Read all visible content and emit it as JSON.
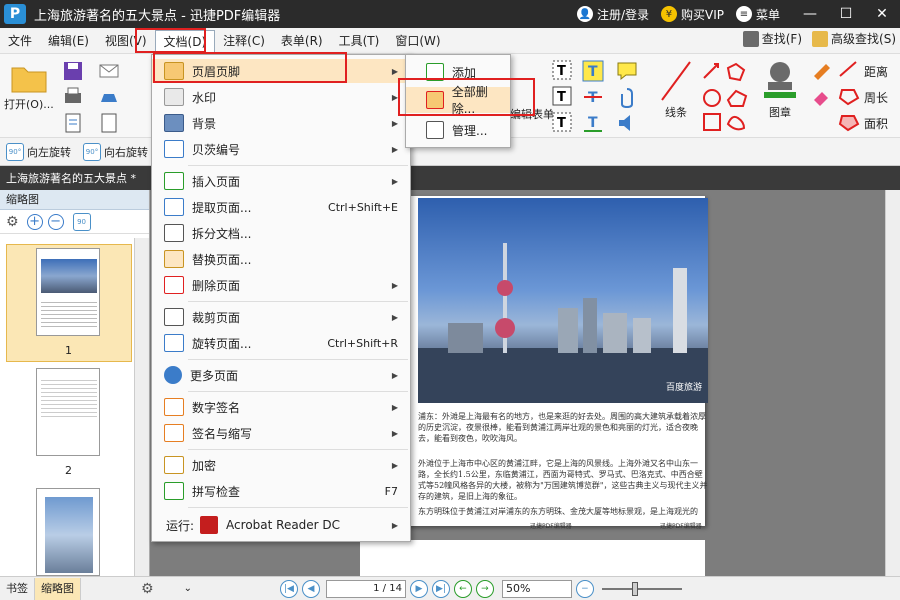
{
  "title_bar": {
    "logo": "P",
    "title": "上海旅游著名的五大景点 - 迅捷PDF编辑器",
    "login": "注册/登录",
    "vip": "购买VIP",
    "menu": "菜单"
  },
  "menubar": {
    "items": [
      "文件",
      "编辑(E)",
      "视图(V)",
      "文档(D)",
      "注释(C)",
      "表单(R)",
      "工具(T)",
      "窗口(W)"
    ],
    "active": "文档(D)",
    "find": "查找(F)",
    "adv_find": "高级查找(S)"
  },
  "ribbon": {
    "open": "打开(O)...",
    "sign": "编辑表单",
    "line": "线条",
    "stamp": "图章",
    "distance": "距离",
    "perimeter": "周长",
    "area": "面积"
  },
  "rotate": {
    "left": "向左旋转",
    "right": "向右旋转"
  },
  "doc_tab": "上海旅游著名的五大景点 *",
  "left_panel": {
    "title": "缩略图",
    "thumbs": [
      "1",
      "2"
    ]
  },
  "document": {
    "para1": "浦东：外滩是上海最有名的地方，也是来逛的好去处。周围的高大建筑承载着浓厚的历史沉淀，夜景很棒，能看到黄浦江两岸壮观的景色和亮丽的灯光，适合夜晚去，能看到夜色，吹吹海风。",
    "para2": "外滩位于上海市中心区的黄浦江畔，它是上海的风景线。上海外滩又名中山东一路，全长约1.5公里，东临黄浦江，西面为哥特式、罗马式、巴洛克式、中西合壁式等52幢风格各异的大楼，被称为\"万国建筑博览群\"，这些古典主义与现代主义并存的建筑，是旧上海的象征。",
    "para3": "东方明珠位于黄浦江对岸浦东的东方明珠、金茂大厦等地标景观，是上海观光的",
    "footer": "迅捷PDF编辑器",
    "photo_watermark": "百度旅游"
  },
  "dropdown": {
    "items": [
      {
        "label": "页眉页脚",
        "arrow": true
      },
      {
        "label": "水印",
        "arrow": true
      },
      {
        "label": "背景",
        "arrow": true
      },
      {
        "label": "贝茨编号",
        "arrow": true
      },
      {
        "label": "插入页面",
        "arrow": true
      },
      {
        "label": "提取页面...",
        "shortcut": "Ctrl+Shift+E"
      },
      {
        "label": "拆分文档..."
      },
      {
        "label": "替换页面..."
      },
      {
        "label": "删除页面",
        "arrow": true
      },
      {
        "label": "裁剪页面",
        "arrow": true
      },
      {
        "label": "旋转页面...",
        "shortcut": "Ctrl+Shift+R"
      },
      {
        "label": "更多页面",
        "arrow": true
      },
      {
        "label": "数字签名",
        "arrow": true
      },
      {
        "label": "签名与缩写",
        "arrow": true
      },
      {
        "label": "加密",
        "arrow": true
      },
      {
        "label": "拼写检查",
        "shortcut": "F7"
      },
      {
        "label": "运行:",
        "extra": "Acrobat Reader DC",
        "arrow": true
      }
    ]
  },
  "submenu": {
    "items": [
      "添加",
      "全部删除...",
      "管理..."
    ]
  },
  "statusbar": {
    "tab_bookmark": "书签",
    "tab_thumb": "缩略图",
    "page_input": "1 / 14",
    "zoom": "50%"
  },
  "colors": {
    "accent": "#2a8fd6",
    "highlight_red": "#e02020",
    "selected": "#fbe7b5"
  }
}
